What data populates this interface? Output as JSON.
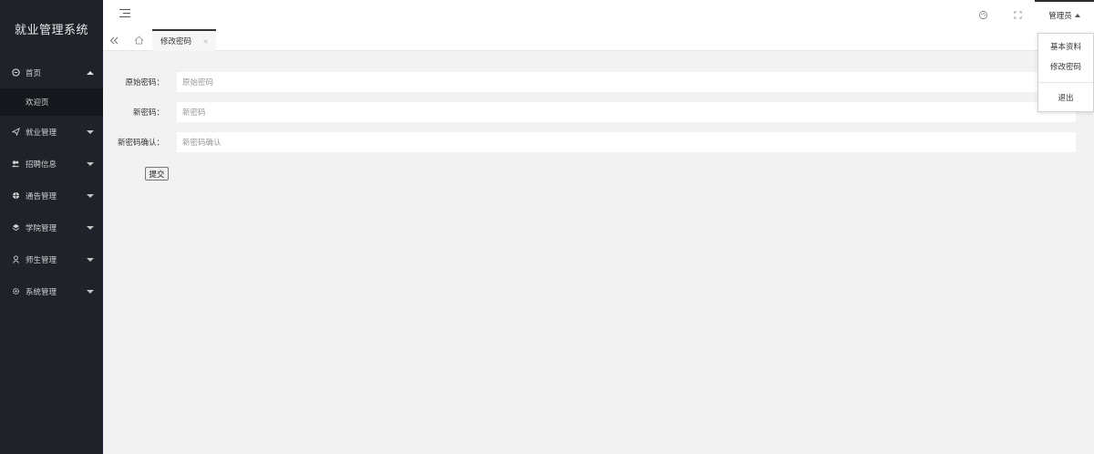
{
  "sidebar": {
    "logo": "就业管理系统",
    "items": [
      {
        "label": "首页",
        "icon": "home-circle-icon",
        "expanded": true,
        "children": [
          "欢迎页"
        ]
      },
      {
        "label": "就业管理",
        "icon": "paper-plane-icon",
        "expanded": false
      },
      {
        "label": "招聘信息",
        "icon": "users-icon",
        "expanded": false
      },
      {
        "label": "通告管理",
        "icon": "globe-icon",
        "expanded": false
      },
      {
        "label": "学院管理",
        "icon": "layers-icon",
        "expanded": false
      },
      {
        "label": "师生管理",
        "icon": "user-icon",
        "expanded": false
      },
      {
        "label": "系统管理",
        "icon": "gear-icon",
        "expanded": false
      }
    ]
  },
  "header": {
    "user_label": "管理员"
  },
  "tabs": {
    "active": "修改密码",
    "close": "×"
  },
  "form": {
    "fields": [
      {
        "label": "原始密码：",
        "placeholder": "原始密码"
      },
      {
        "label": "新密码：",
        "placeholder": "新密码"
      },
      {
        "label": "新密码确认：",
        "placeholder": "新密码确认"
      }
    ],
    "submit_label": "提交"
  },
  "user_menu": {
    "items": [
      "基本资料",
      "修改密码"
    ],
    "logout": "退出"
  },
  "colors": {
    "sidebar_bg": "#20222a",
    "sidebar_sub_bg": "#16171c",
    "content_bg": "#f2f2f2",
    "active_tab_border": "#333333"
  }
}
